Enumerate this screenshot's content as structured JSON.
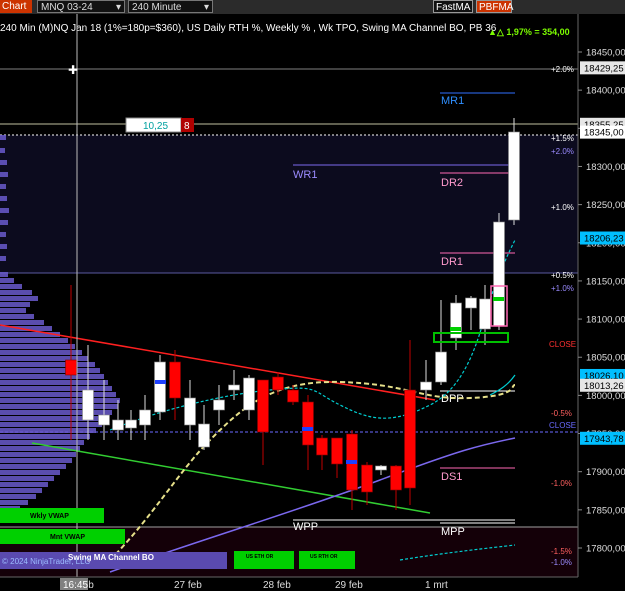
{
  "toolbar": {
    "app_button_label": "Chart",
    "instrument_value": "MNQ 03-24",
    "interval_value": "240 Minute",
    "fastma_label": "FastMA",
    "pbfma_label": "PBFMA"
  },
  "chart_header": {
    "title": "240 Min (M)NQ Jan 18 (1%=180p=$360), US Daily RTH %, Weekly % , Wk TPO, Swing MA Channel BO, PB 36",
    "change_readout": "▲△ 1,97% = 354,00"
  },
  "price_axis": {
    "ticks": [
      "18450,00",
      "18400,00",
      "18350,00",
      "18300,00",
      "18250,00",
      "18200,00",
      "18150,00",
      "18100,00",
      "18050,00",
      "18000,00",
      "17950,00",
      "17900,00",
      "17850,00",
      "17800,00"
    ],
    "price_max": 18470,
    "price_min": 17770,
    "price_labels": [
      {
        "text": "18429,25",
        "price": 18429.25,
        "bg": "#e6e6e6",
        "fg": "#000000"
      },
      {
        "text": "18355,25",
        "price": 18355.25,
        "bg": "#e6e6e6",
        "fg": "#000000"
      },
      {
        "text": "18345,00",
        "price": 18345.0,
        "bg": "#ffffff",
        "fg": "#000000"
      },
      {
        "text": "18206,23",
        "price": 18206.23,
        "bg": "#00bfff",
        "fg": "#000000"
      },
      {
        "text": "18026,10",
        "price": 18026.1,
        "bg": "#00bfff",
        "fg": "#000000"
      },
      {
        "text": "18013,26",
        "price": 18013.26,
        "bg": "#e6e6e6",
        "fg": "#000000"
      },
      {
        "text": "17943,78",
        "price": 17943.78,
        "bg": "#00bfff",
        "fg": "#000000"
      }
    ]
  },
  "time_axis": {
    "labels": [
      "26 feb",
      "27 feb",
      "28 feb",
      "29 feb",
      "1 mrt"
    ],
    "crosshair_time": "16:45"
  },
  "level_labels": {
    "mr1": "MR1",
    "dr2": "DR2",
    "wr1": "WR1",
    "dr1": "DR1",
    "dpp": "DPP",
    "ds1": "DS1",
    "wpp": "WPP",
    "mpp": "MPP",
    "close": "CLOSE"
  },
  "percent_labels": {
    "p2_0_top": "+2.0%",
    "p1_5": "+1.5%",
    "p2_0": "+2.0%",
    "p1_0": "+1.0%",
    "p0_5": "+0.5%",
    "p1_0b": "+1.0%",
    "close": "CLOSE",
    "m0_5": "-0.5%",
    "close2": "CLOSE",
    "m1_0": "-1.0%",
    "m1_5": "-1.5%",
    "m1_0b": "-1.0%"
  },
  "tags": {
    "weekly_vwap": "Wkly VWAP",
    "monthly_vwap": "Mnt VWAP",
    "swing_channel": "Swing MA Channel BO",
    "us_eth_or": "US ETH OR",
    "us_rth_or": "US RTH OR",
    "copyright": "© 2024 NinjaTrader, LLC"
  },
  "crosshair_box": {
    "value": "10,25",
    "count": "8"
  },
  "colors": {
    "background": "#000000",
    "up_candle": "#ffffff",
    "down_candle": "#ff0000",
    "profile": "#6a5acd",
    "vwap_green": "#00e000",
    "channel_cyan": "#00ced1",
    "ma_yellow": "#e6e08a",
    "trend_red": "#ff2020",
    "trend_green": "#32cd32"
  }
}
